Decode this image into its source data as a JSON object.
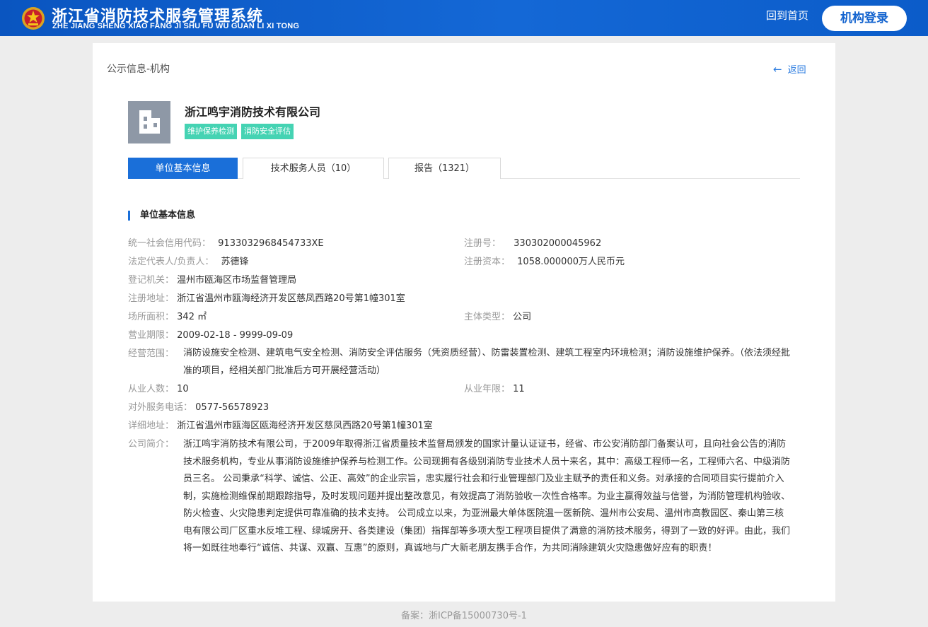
{
  "header": {
    "title": "浙江省消防技术服务管理系统",
    "pinyin": "ZHE JIANG SHENG XIAO FANG JI SHU FU WU GUAN LI XI TONG",
    "home_label": "回到首页",
    "login_label": "机构登录",
    "emblem_icon": "fire-emblem-icon"
  },
  "page": {
    "breadcrumb": "公示信息-机构",
    "back_label": "返回",
    "back_icon": "arrow-left-icon"
  },
  "company": {
    "name": "浙江鸣宇消防技术有限公司",
    "logo_icon": "building-icon",
    "tags": [
      "维护保养检测",
      "消防安全评估"
    ]
  },
  "tabs": [
    {
      "label": "单位基本信息",
      "active": true
    },
    {
      "label": "技术服务人员（10）",
      "active": false
    },
    {
      "label": "报告（1321）",
      "active": false
    }
  ],
  "section": {
    "title": "单位基本信息"
  },
  "info": {
    "credit_code": {
      "label": "统一社会信用代码：",
      "value": "9133032968454733XE"
    },
    "reg_no": {
      "label": "注册号：",
      "value": "330302000045962"
    },
    "legal_rep": {
      "label": "法定代表人/负责人：",
      "value": "苏德锋"
    },
    "reg_capital": {
      "label": "注册资本：",
      "value": "1058.000000万人民币元"
    },
    "reg_authority": {
      "label": "登记机关：",
      "value": "温州市瓯海区市场监督管理局"
    },
    "reg_address": {
      "label": "注册地址：",
      "value": "浙江省温州市瓯海经济开发区慈凤西路20号第1幢301室"
    },
    "area": {
      "label": "场所面积：",
      "value": "342 ㎡"
    },
    "entity_type": {
      "label": "主体类型：",
      "value": "公司"
    },
    "business_term": {
      "label": "营业期限：",
      "value": "2009-02-18 - 9999-09-09"
    },
    "scope": {
      "label": "经营范围：",
      "value": "消防设施安全检测、建筑电气安全检测、消防安全评估服务（凭资质经营）、防雷装置检测、建筑工程室内环境检测；消防设施维护保养。（依法须经批准的项目，经相关部门批准后方可开展经营活动）"
    },
    "employees": {
      "label": "从业人数：",
      "value": "10"
    },
    "years": {
      "label": "从业年限：",
      "value": "11"
    },
    "phone": {
      "label": "对外服务电话：",
      "value": "0577-56578923"
    },
    "address": {
      "label": "详细地址：",
      "value": "浙江省温州市瓯海区瓯海经济开发区慈凤西路20号第1幢301室"
    },
    "intro": {
      "label": "公司简介：",
      "value": "浙江鸣宇消防技术有限公司，于2009年取得浙江省质量技术监督局颁发的国家计量认证证书，经省、市公安消防部门备案认可，且向社会公告的消防技术服务机构，专业从事消防设施维护保养与检测工作。公司现拥有各级别消防专业技术人员十来名，其中：高级工程师一名，工程师六名、中级消防员三名。 公司秉承“科学、诚信、公正、高效”的企业宗旨，忠实履行社会和行业管理部门及业主赋予的责任和义务。对承接的合同项目实行提前介入制，实施检测维保前期跟踪指导，及时发现问题并提出整改意见，有效提高了消防验收一次性合格率。为业主赢得效益与信誉，为消防管理机构验收、防火检查、火灾隐患判定提供可靠准确的技术支持。 公司成立以来，为亚洲最大单体医院温一医新院、温州市公安局、温州市高教园区、秦山第三核电有限公司厂区重水反堆工程、绿城房开、各类建设（集团）指挥部等多项大型工程项目提供了满意的消防技术服务，得到了一致的好评。由此，我们将一如既往地奉行“诚信、共谋、双赢、互惠”的原则，真诚地与广大新老朋友携手合作，为共同消除建筑火灾隐患做好应有的职责！"
    }
  },
  "footer": {
    "icp": "备案：浙ICP备15000730号-1"
  },
  "colors": {
    "header_blue": "#1468d6",
    "accent_blue": "#1a6fd9",
    "tag_green": "#45d3b3"
  }
}
